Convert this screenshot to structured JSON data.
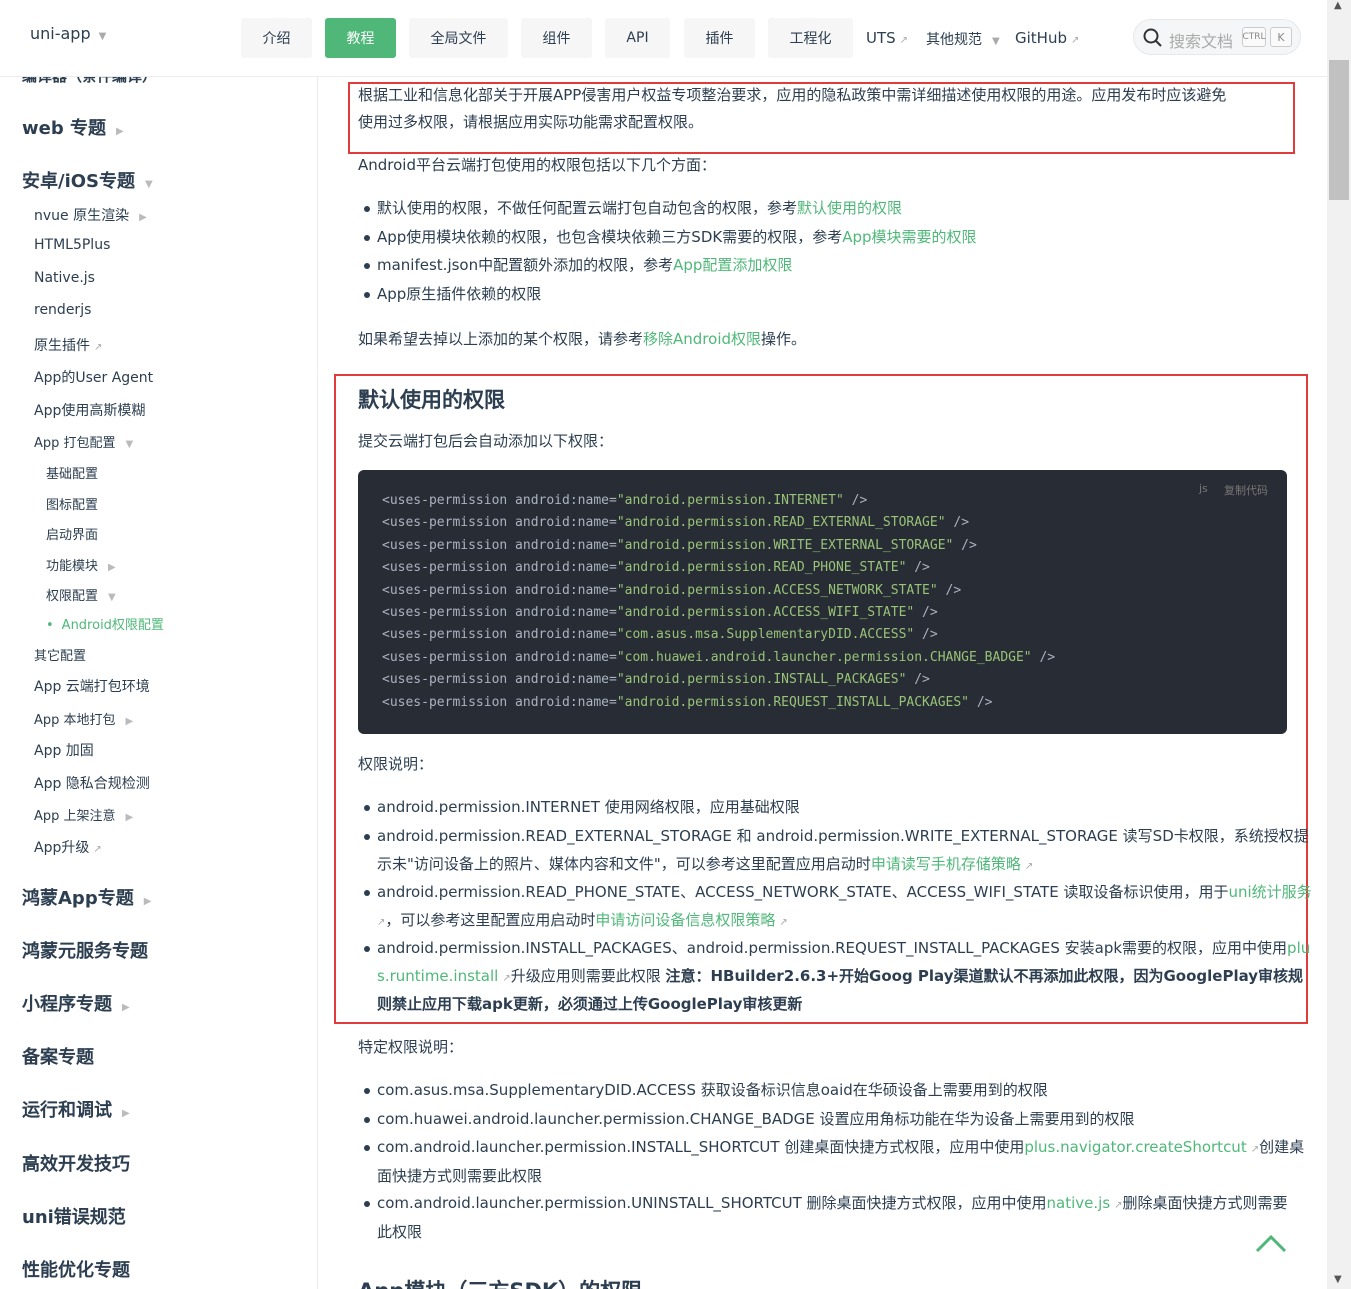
{
  "header": {
    "brand": "uni-app",
    "nav": [
      "介绍",
      "教程",
      "全局文件",
      "组件",
      "API",
      "插件",
      "工程化"
    ],
    "links": [
      "UTS",
      "其他规范",
      "GitHub"
    ],
    "search_placeholder": "搜索文档",
    "kbd": [
      "CTRL",
      "K"
    ]
  },
  "sidebar": {
    "cut_top": "编译器（条件编译）",
    "items": [
      "web 专题",
      "安卓/iOS专题",
      "nvue 原生渲染",
      "HTML5Plus",
      "Native.js",
      "renderjs",
      "原生插件",
      "App的User Agent",
      "App使用高斯模糊",
      "App 打包配置",
      "基础配置",
      "图标配置",
      "启动界面",
      "功能模块",
      "权限配置",
      "Android权限配置",
      "其它配置",
      "App 云端打包环境",
      "App 本地打包",
      "App 加固",
      "App 隐私合规检测",
      "App 上架注意",
      "App升级",
      "鸿蒙App专题",
      "鸿蒙元服务专题",
      "小程序专题",
      "备案专题",
      "运行和调试",
      "高效开发技巧",
      "uni错误规范",
      "性能优化专题"
    ]
  },
  "content": {
    "intro1": "根据工业和信息化部关于开展APP侵害用户权益专项整治要求，应用的隐私政策中需详细描述使用权限的用途。应用发布时应该避免",
    "intro2": "使用过多权限，请根据应用实际功能需求配置权限。",
    "aspects": "Android平台云端打包使用的权限包括以下几个方面：",
    "b1_text": "默认使用的权限，不做任何配置云端打包自动包含的权限，参考",
    "b1_link": "默认使用的权限",
    "b2_text": "App使用模块依赖的权限，也包含模块依赖三方SDK需要的权限，参考",
    "b2_link": "App模块需要的权限",
    "b3_text": "manifest.json中配置额外添加的权限，参考",
    "b3_link": "App配置添加权限",
    "b4_text": "App原生插件依赖的权限",
    "remove_text": "如果希望去掉以上添加的某个权限，请参考",
    "remove_link": "移除Android权限",
    "remove_tail": "操作。",
    "default_title": "默认使用的权限",
    "default_desc": "提交云端打包后会自动添加以下权限：",
    "code_lang": "js",
    "code_copy": "复制代码",
    "code_prefix": "<uses-permission android:name=",
    "code_suffix": " />",
    "code_lines": [
      "\"android.permission.INTERNET\"",
      "\"android.permission.READ_EXTERNAL_STORAGE\"",
      "\"android.permission.WRITE_EXTERNAL_STORAGE\"",
      "\"android.permission.READ_PHONE_STATE\"",
      "\"android.permission.ACCESS_NETWORK_STATE\"",
      "\"android.permission.ACCESS_WIFI_STATE\"",
      "\"com.asus.msa.SupplementaryDID.ACCESS\"",
      "\"com.huawei.android.launcher.permission.CHANGE_BADGE\"",
      "\"android.permission.INSTALL_PACKAGES\"",
      "\"android.permission.REQUEST_INSTALL_PACKAGES\""
    ],
    "perm_title": "权限说明：",
    "p1": "android.permission.INTERNET 使用网络权限，应用基础权限",
    "p2a": "android.permission.READ_EXTERNAL_STORAGE 和 android.permission.WRITE_EXTERNAL_STORAGE 读写SD卡权限，系统授权提",
    "p2b": "示未\"访问设备上的照片、媒体内容和文件\"，可以参考这里配置应用启动时",
    "p2_link": "申请读写手机存储策略",
    "p3a": "android.permission.READ_PHONE_STATE、ACCESS_NETWORK_STATE、ACCESS_WIFI_STATE 读取设备标识使用，用于",
    "p3_link1": "uni统计服务",
    "p3b": "，可以参考这里配置应用启动时",
    "p3_link2": "申请访问设备信息权限策略",
    "p4a": "android.permission.INSTALL_PACKAGES、android.permission.REQUEST_INSTALL_PACKAGES 安装apk需要的权限，应用中使用",
    "p4_link1": "plu",
    "p4_link2": "s.runtime.install",
    "p4b": "升级应用则需要此权限 ",
    "p4_bold1": "注意：HBuilder2.6.3+开始Goog Play渠道默认不再添加此权限，因为GooglePlay审核规",
    "p4_bold2": "则禁止应用下载apk更新，必须通过上传GooglePlay审核更新",
    "special_title": "特定权限说明：",
    "s1": "com.asus.msa.SupplementaryDID.ACCESS 获取设备标识信息oaid在华硕设备上需要用到的权限",
    "s2": "com.huawei.android.launcher.permission.CHANGE_BADGE 设置应用角标功能在华为设备上需要用到的权限",
    "s3a": "com.android.launcher.permission.INSTALL_SHORTCUT 创建桌面快捷方式权限，应用中使用",
    "s3_link": "plus.navigator.createShortcut",
    "s3b": "创建桌",
    "s3c": "面快捷方式则需要此权限",
    "s4a": "com.android.launcher.permission.UNINSTALL_SHORTCUT 删除桌面快捷方式权限，应用中使用",
    "s4_link": "native.js",
    "s4b": "删除桌面快捷方式则需要",
    "s4c": "此权限",
    "next_title_cut": "App模块（三方SDK）的权限"
  },
  "colors": {
    "accent": "#4fb879",
    "highlight_border": "#e03c3c",
    "code_bg": "#282c34"
  }
}
